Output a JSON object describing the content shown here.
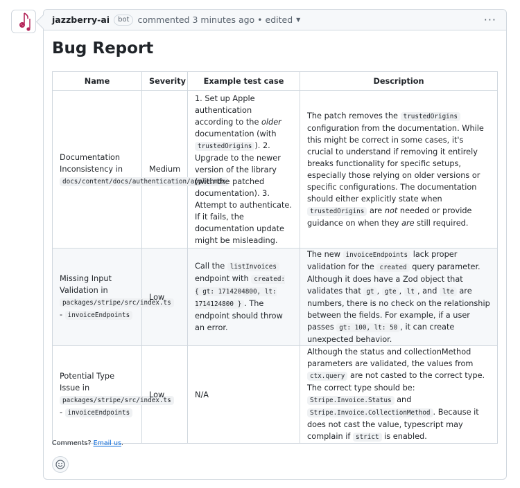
{
  "comment": {
    "author": "jazzberry-ai",
    "badge": "bot",
    "meta": "commented 3 minutes ago • edited",
    "more": "···"
  },
  "report": {
    "title": "Bug Report",
    "headers": [
      "Name",
      "Severity",
      "Example test case",
      "Description"
    ],
    "rows": [
      {
        "name": [
          {
            "t": "Documentation Inconsistency in "
          },
          {
            "c": "docs/content/docs/authentication/apple.mdx"
          }
        ],
        "severity": "Medium",
        "test": [
          {
            "t": "1. Set up Apple authentication according to the "
          },
          {
            "i": "older"
          },
          {
            "t": " documentation (with "
          },
          {
            "c": "trustedOrigins"
          },
          {
            "t": "). 2. Upgrade to the newer version of the library (with the patched documentation). 3. Attempt to authenticate. If it fails, the documentation update might be misleading."
          }
        ],
        "desc": [
          {
            "t": "The patch removes the "
          },
          {
            "c": "trustedOrigins"
          },
          {
            "t": " configuration from the documentation. While this might be correct in some cases, it's crucial to understand if removing it entirely breaks functionality for specific setups, especially those relying on older versions or specific configurations. The documentation should either explicitly state when "
          },
          {
            "c": "trustedOrigins"
          },
          {
            "t": " are "
          },
          {
            "i": "not"
          },
          {
            "t": " needed or provide guidance on when they "
          },
          {
            "i": "are"
          },
          {
            "t": " still required."
          }
        ]
      },
      {
        "name": [
          {
            "t": "Missing Input Validation in "
          },
          {
            "c": "packages/stripe/src/index.ts"
          },
          {
            "t": " - "
          },
          {
            "c": "invoiceEndpoints"
          }
        ],
        "severity": "Low",
        "test": [
          {
            "t": "Call the "
          },
          {
            "c": "listInvoices"
          },
          {
            "t": " endpoint with "
          },
          {
            "c": "created: { gt: 1714204800, lt: 1714124800 }"
          },
          {
            "t": ". The endpoint should throw an error."
          }
        ],
        "desc": [
          {
            "t": "The new "
          },
          {
            "c": "invoiceEndpoints"
          },
          {
            "t": " lack proper validation for the "
          },
          {
            "c": "created"
          },
          {
            "t": " query parameter. Although it does have a Zod object that validates that "
          },
          {
            "c": "gt"
          },
          {
            "t": ", "
          },
          {
            "c": "gte"
          },
          {
            "t": ", "
          },
          {
            "c": "lt"
          },
          {
            "t": ", and "
          },
          {
            "c": "lte"
          },
          {
            "t": " are numbers, there is no check on the relationship between the fields. For example, if a user passes "
          },
          {
            "c": "gt: 100, lt: 50"
          },
          {
            "t": ", it can create unexpected behavior."
          }
        ]
      },
      {
        "name": [
          {
            "t": "Potential Type Issue in "
          },
          {
            "c": "packages/stripe/src/index.ts"
          },
          {
            "t": " - "
          },
          {
            "c": "invoiceEndpoints"
          }
        ],
        "severity": "Low",
        "test": [
          {
            "t": "N/A"
          }
        ],
        "desc": [
          {
            "t": "Although the status and collectionMethod parameters are validated, the values from "
          },
          {
            "c": "ctx.query"
          },
          {
            "t": " are not casted to the correct type. The correct type should be: "
          },
          {
            "c": "Stripe.Invoice.Status"
          },
          {
            "t": " and "
          },
          {
            "c": "Stripe.Invoice.CollectionMethod"
          },
          {
            "t": ". Because it does not cast the value, typescript may complain if "
          },
          {
            "c": "strict"
          },
          {
            "t": " is enabled."
          }
        ]
      }
    ]
  },
  "footer": {
    "prefix": "Comments? ",
    "link": "Email us",
    "suffix": "."
  },
  "colors": {
    "border": "#d0d7de",
    "header_bg": "#f6f8fa",
    "link": "#0969da",
    "logo": "#b3265a"
  }
}
